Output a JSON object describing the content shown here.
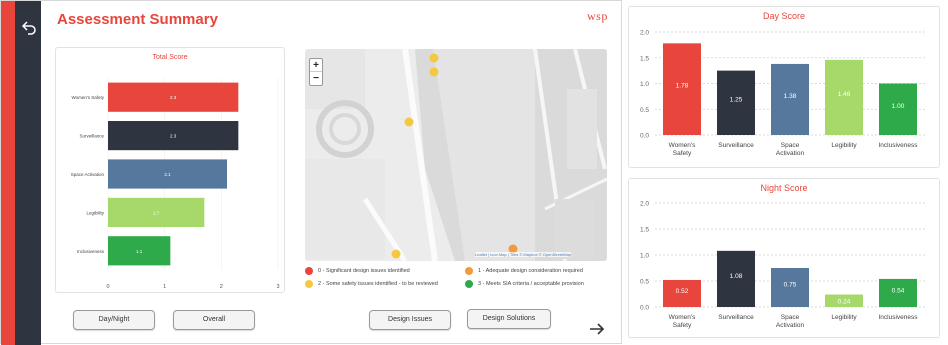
{
  "app": {
    "title": "Assessment Summary",
    "logo_text": "wsp",
    "back_icon": "back-arrow-icon",
    "next_icon": "arrow-right-icon"
  },
  "colors": {
    "accent": "#e8463c",
    "red": "#e8463c",
    "dark": "#2e3440",
    "steel": "#56789c",
    "lightgreen": "#a6d96a",
    "green": "#2eaa4a",
    "amber": "#f29b3a",
    "yellow": "#f5c842"
  },
  "buttons": {
    "day_night": "Day/Night",
    "overall": "Overall",
    "design_issues": "Design Issues",
    "design_solutions": "Design Solutions"
  },
  "map": {
    "zoom_in": "+",
    "zoom_out": "−",
    "attribution": "Leaflet | Icon Map | Tiles © Mapbox © OpenStreetMap",
    "legend": [
      {
        "label": "0 - Significant design issues identified",
        "color": "#e8463c"
      },
      {
        "label": "1 - Adequate design consideration required",
        "color": "#f29b3a"
      },
      {
        "label": "2 - Some safety issues identified - to be reviewed",
        "color": "#f5c842"
      },
      {
        "label": "3 - Meets SIA criteria / acceptable provision",
        "color": "#2eaa4a"
      }
    ]
  },
  "chart_data": [
    {
      "type": "bar",
      "orientation": "horizontal",
      "title": "Total Score",
      "categories": [
        "Women's Safety",
        "Surveillance",
        "Space Activation",
        "Legibility",
        "Inclusiveness"
      ],
      "values": [
        2.3,
        2.3,
        2.1,
        1.7,
        1.1
      ],
      "labels": [
        "2.3",
        "2.3",
        "2.1",
        "1.7",
        "1.1"
      ],
      "colors": [
        "#e8463c",
        "#2e3440",
        "#56789c",
        "#a6d96a",
        "#2eaa4a"
      ],
      "xlim": [
        0,
        3
      ],
      "ticks": [
        "0",
        "1",
        "2",
        "3"
      ]
    },
    {
      "type": "bar",
      "title": "Day Score",
      "categories": [
        "Women's Safety",
        "Surveillance",
        "Space Activation",
        "Legibility",
        "Inclusiveness"
      ],
      "values": [
        1.78,
        1.25,
        1.38,
        1.46,
        1.0
      ],
      "labels": [
        "1.78",
        "1.25",
        "1.38",
        "1.46",
        "1.00"
      ],
      "colors": [
        "#e8463c",
        "#2e3440",
        "#56789c",
        "#a6d96a",
        "#2eaa4a"
      ],
      "ylim": [
        0,
        2
      ],
      "ticks": [
        "0.0",
        "0.5",
        "1.0",
        "1.5",
        "2.0"
      ]
    },
    {
      "type": "bar",
      "title": "Night Score",
      "categories": [
        "Women's Safety",
        "Surveillance",
        "Space Activation",
        "Legibility",
        "Inclusiveness"
      ],
      "values": [
        0.52,
        1.08,
        0.75,
        0.24,
        0.54
      ],
      "labels": [
        "0.52",
        "1.08",
        "0.75",
        "0.24",
        "0.54"
      ],
      "colors": [
        "#e8463c",
        "#2e3440",
        "#56789c",
        "#a6d96a",
        "#2eaa4a"
      ],
      "ylim": [
        0,
        2
      ],
      "ticks": [
        "0.0",
        "0.5",
        "1.0",
        "1.5",
        "2.0"
      ]
    }
  ]
}
